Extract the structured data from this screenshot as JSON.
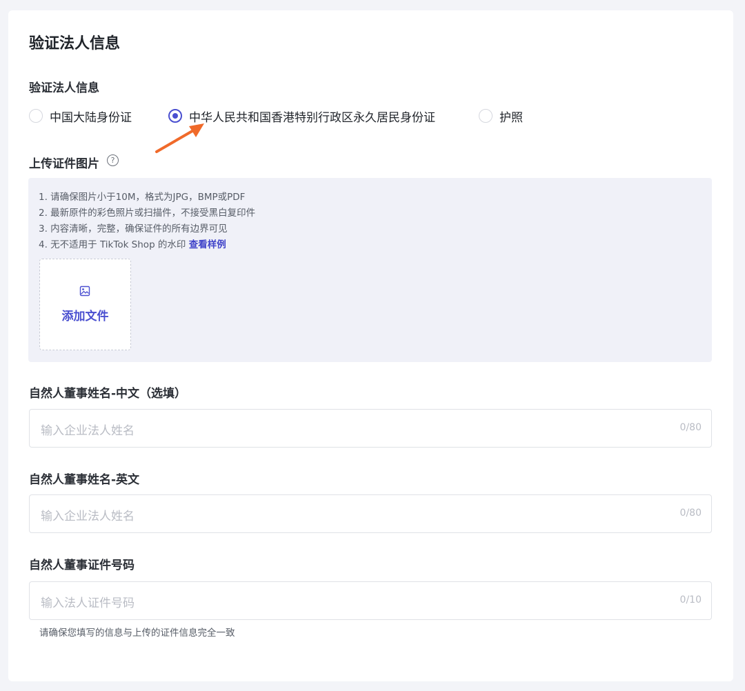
{
  "page": {
    "title": "验证法人信息"
  },
  "id_type": {
    "label": "验证法人信息",
    "options": [
      {
        "label": "中国大陆身份证",
        "checked": false
      },
      {
        "label": "中华人民共和国香港特别行政区永久居民身份证",
        "checked": true
      },
      {
        "label": "护照",
        "checked": false
      }
    ]
  },
  "upload": {
    "label": "上传证件图片",
    "help_icon": "question-circle-icon",
    "tips": [
      "1. 请确保图片小于10M，格式为JPG，BMP或PDF",
      "2. 最新原件的彩色照片或扫描件，不接受黑白复印件",
      "3. 内容清晰，完整，确保证件的所有边界可见",
      "4. 无不适用于 TikTok Shop 的水印"
    ],
    "sample_link": "查看样例",
    "add_file_icon": "image-icon",
    "add_file_label": "添加文件"
  },
  "fields": {
    "name_cn": {
      "label": "自然人董事姓名-中文（选填）",
      "placeholder": "输入企业法人姓名",
      "count": "0/80"
    },
    "name_en": {
      "label": "自然人董事姓名-英文",
      "placeholder": "输入企业法人姓名",
      "count": "0/80"
    },
    "id_number": {
      "label": "自然人董事证件号码",
      "placeholder": "输入法人证件号码",
      "count": "0/10"
    }
  },
  "hint": "请确保您填写的信息与上传的证件信息完全一致",
  "colors": {
    "accent": "#4a4fd0",
    "annotation_arrow": "#f06a2a"
  }
}
